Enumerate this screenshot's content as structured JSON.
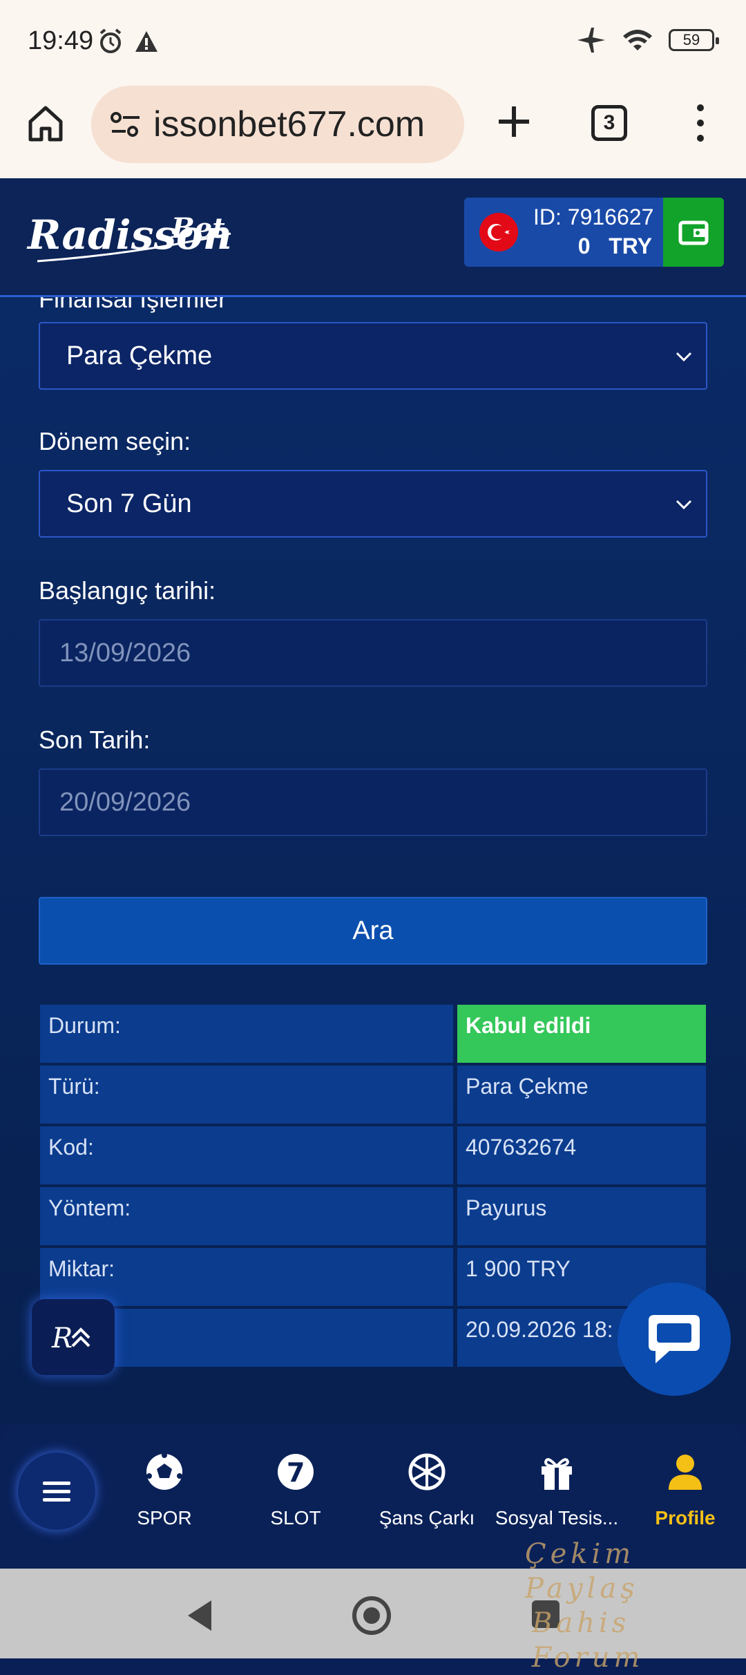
{
  "status_bar": {
    "time": "19:49",
    "battery": "59"
  },
  "browser": {
    "url": "issonbet677.com",
    "tab_count": "3"
  },
  "header": {
    "logo_text": "RadissonBet",
    "account_id": "ID: 7916627",
    "balance": "0",
    "currency": "TRY"
  },
  "form": {
    "cut_label": "Finansal İşlemler",
    "transaction_type": "Para Çekme",
    "period_label": "Dönem seçin:",
    "period_value": "Son 7 Gün",
    "start_label": "Başlangıç tarihi:",
    "start_value": "13/09/2026",
    "end_label": "Son Tarih:",
    "end_value": "20/09/2026",
    "search_button": "Ara"
  },
  "result": {
    "rows": [
      {
        "label": "Durum:",
        "value": "Kabul edildi"
      },
      {
        "label": "Türü:",
        "value": "Para Çekme"
      },
      {
        "label": "Kod:",
        "value": "407632674"
      },
      {
        "label": "Yöntem:",
        "value": "Payurus"
      },
      {
        "label": "Miktar:",
        "value": "1 900 TRY"
      },
      {
        "label": "",
        "value": "20.09.2026 18:"
      }
    ]
  },
  "nav": {
    "items": [
      {
        "label": "SPOR",
        "icon": "soccer-ball-icon"
      },
      {
        "label": "SLOT",
        "icon": "slot-seven-icon"
      },
      {
        "label": "Şans Çarkı",
        "icon": "wheel-icon"
      },
      {
        "label": "Sosyal Tesis...",
        "icon": "gift-icon"
      },
      {
        "label": "Profile",
        "icon": "user-icon"
      }
    ]
  },
  "watermark": {
    "line1": "Çekim Paylaş",
    "line2": "Bahis Forum"
  },
  "colors": {
    "accent": "#0b4fae",
    "success": "#34c759",
    "active": "#f5c016"
  }
}
